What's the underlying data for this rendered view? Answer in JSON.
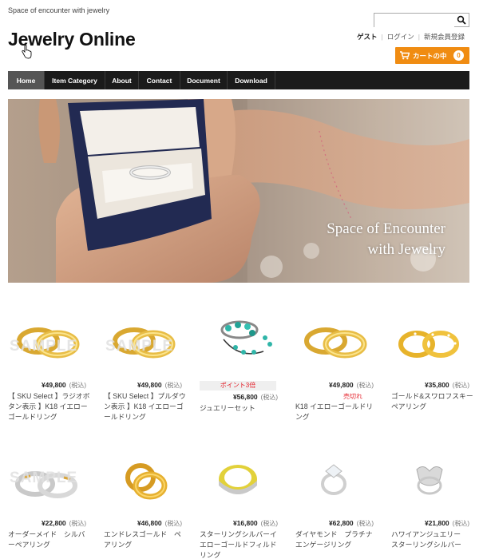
{
  "header": {
    "tagline": "Space of encounter with jewelry",
    "site_title": "Jewelry Online",
    "search": {
      "value": "",
      "placeholder": ""
    },
    "user_links": {
      "guest": "ゲスト",
      "login": "ログイン",
      "register": "新規会員登録"
    },
    "cart": {
      "label": "カートの中",
      "count": "0"
    },
    "accent_color": "#f08c12"
  },
  "nav": {
    "items": [
      {
        "label": "Home",
        "active": true
      },
      {
        "label": "Item Category"
      },
      {
        "label": "About"
      },
      {
        "label": "Contact"
      },
      {
        "label": "Document"
      },
      {
        "label": "Download"
      }
    ]
  },
  "hero": {
    "line1": "Space of Encounter",
    "line2": "with Jewelry"
  },
  "products": [
    {
      "price": "¥49,800",
      "tax": "(税込)",
      "name": "【 SKU Select 】ラジオボタン表示 】K18 イエローゴールドリング",
      "watermark": "SAMPLE"
    },
    {
      "price": "¥49,800",
      "tax": "(税込)",
      "name": "【 SKU Select 】プルダウン表示 】K18 イエローゴールドリング",
      "watermark": "SAMPLE"
    },
    {
      "badge": "ポイント3倍",
      "price": "¥56,800",
      "tax": "(税込)",
      "name": "ジュエリーセット"
    },
    {
      "price": "¥49,800",
      "tax": "(税込)",
      "soldout": "売切れ",
      "name": "K18 イエローゴールドリング"
    },
    {
      "price": "¥35,800",
      "tax": "(税込)",
      "name": "ゴールド&スワロフスキーペアリング"
    },
    {
      "price": "¥22,800",
      "tax": "(税込)",
      "name": "オーダーメイド　シルバーペアリング",
      "watermark": "SAMPLE"
    },
    {
      "price": "¥46,800",
      "tax": "(税込)",
      "name": "エンドレスゴールド　ペアリング"
    },
    {
      "price": "¥16,800",
      "tax": "(税込)",
      "name": "スターリングシルバーイエローゴールドフィルドリング"
    },
    {
      "price": "¥62,800",
      "tax": "(税込)",
      "name": "ダイヤモンド　プラチナエンゲージリング"
    },
    {
      "price": "¥21,800",
      "tax": "(税込)",
      "name": "ハワイアンジュエリー　スターリングシルバー"
    }
  ]
}
